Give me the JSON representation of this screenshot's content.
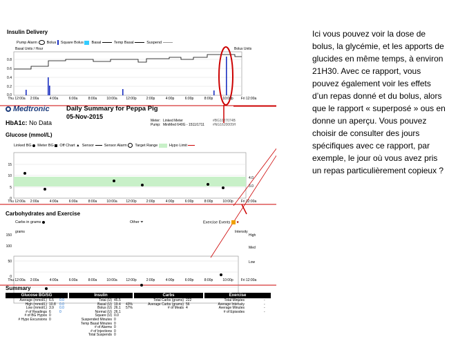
{
  "insulin_delivery": {
    "title": "Insulin Delivery",
    "legend": {
      "pump_alarm": "Pump Alarm",
      "bolus": "Bolus",
      "square_bolus": "Square Bolus",
      "basal": "Basal",
      "temp_basal": "Temp Basal",
      "suspend": "Suspend"
    },
    "y_label_left": "Basal Units / Hour",
    "y_label_right": "Bolus Units",
    "y_ticks": [
      "0.8",
      "0.6",
      "0.4",
      "0.2",
      "0.0"
    ],
    "x_ticks": [
      "Thu 12:00a",
      "2:00a",
      "4:00a",
      "6:00a",
      "8:00a",
      "10:00a",
      "12:00p",
      "2:00p",
      "4:00p",
      "6:00p",
      "8:00p",
      "10:00p",
      "Fri 12:00a"
    ]
  },
  "header": {
    "brand": "Medtronic",
    "title": "Daily Summary for Peppa Pig",
    "date": "05-Nov-2015",
    "meter_label": "Meter:",
    "meter_value": "Linked Meter",
    "meter_id": "#BG1027074B",
    "pump_label": "Pump:",
    "pump_value": "MiniMed 640G - 1511/1711",
    "pump_id": "#NG1620005H"
  },
  "hba1c": {
    "label": "HbA1c:",
    "value": "No Data"
  },
  "glucose": {
    "title": "Glucose (mmol/L)",
    "legend": {
      "linked_bg": "Linked BG",
      "meter_bg": "Meter BG",
      "off_chart": "Off Chart",
      "sensor": "Sensor",
      "sensor_alarm": "Sensor Alarm",
      "target_range": "Target Range",
      "hypo_limit": "Hypo Limit"
    },
    "y_ticks": [
      "15",
      "10",
      "5",
      "0"
    ],
    "right_ticks": [
      "4.0",
      "3.0"
    ],
    "x_ticks": [
      "Thu 12:00a",
      "2:00a",
      "4:00a",
      "6:00a",
      "8:00a",
      "10:00a",
      "12:00p",
      "2:00p",
      "4:00p",
      "6:00p",
      "8:00p",
      "10:00p",
      "Fri 12:00a"
    ]
  },
  "carbs": {
    "title": "Carbohydrates and Exercise",
    "legend": {
      "carbs_in_grams": "Carbs in grams",
      "other": "Other",
      "exercise_events": "Exercise Events"
    },
    "y_label_left": "grams",
    "y_label_right": "Intensity",
    "y_ticks": [
      "150",
      "100",
      "50",
      "0"
    ],
    "right_ticks": [
      "High",
      "Med",
      "Low"
    ],
    "x_ticks": [
      "Thu 12:00a",
      "2:00a",
      "4:00a",
      "6:00a",
      "8:00a",
      "10:00a",
      "12:00p",
      "2:00p",
      "4:00p",
      "6:00p",
      "8:00p",
      "10:00p",
      "Fri 12:00a"
    ]
  },
  "summary": {
    "title": "Summary",
    "glucose": {
      "header": "Glucose BG/SG",
      "rows": [
        {
          "label": "Average (mmol/L)",
          "v1": "6.5",
          "v2": "0.0"
        },
        {
          "label": "High (mmol/L)",
          "v1": "10.8",
          "v2": "0.0"
        },
        {
          "label": "Low (mmol/L)",
          "v1": "3.9",
          "v2": "0.0"
        },
        {
          "label": "# of Readings",
          "v1": "6",
          "v2": "0"
        },
        {
          "label": "# of BG Hypos",
          "v1": "0",
          "v2": ""
        },
        {
          "label": "# Hypo Excursions",
          "v1": "0",
          "v2": ""
        }
      ]
    },
    "insulin": {
      "header": "Insulin",
      "rows": [
        {
          "label": "Total (U)",
          "v1": "45.5",
          "v2": ""
        },
        {
          "label": "Basal (U)",
          "v1": "19.4",
          "v2": "43%"
        },
        {
          "label": "Bolus (U)",
          "v1": "26.1",
          "v2": "57%"
        },
        {
          "label": "Normal (U)",
          "v1": "26.1",
          "v2": ""
        },
        {
          "label": "Square (U)",
          "v1": "0.0",
          "v2": ""
        },
        {
          "label": "Suspended Minutes",
          "v1": "0",
          "v2": ""
        },
        {
          "label": "Temp Basal Minutes",
          "v1": "0",
          "v2": ""
        },
        {
          "label": "# of Alarms",
          "v1": "0",
          "v2": ""
        },
        {
          "label": "# of Injections",
          "v1": "0",
          "v2": ""
        },
        {
          "label": "Total Suspends",
          "v1": "0",
          "v2": ""
        }
      ]
    },
    "carbs": {
      "header": "Carbs",
      "rows": [
        {
          "label": "Total Carbs (grams)",
          "v1": "222"
        },
        {
          "label": "Average Carbs (grams)",
          "v1": "56"
        },
        {
          "label": "# of Meals",
          "v1": "4"
        }
      ]
    },
    "exercise": {
      "header": "Exercise",
      "rows": [
        {
          "label": "Total Minutes",
          "v1": "-"
        },
        {
          "label": "Average Intensity",
          "v1": "-"
        },
        {
          "label": "Average Minutes",
          "v1": "-"
        },
        {
          "label": "# of Episodes",
          "v1": "-"
        }
      ]
    }
  },
  "annotation": {
    "text": "Ici vous pouvez voir la dose de bolus, la glycémie, et les apports de glucides en même temps, à environ 21H30. Avec ce rapport, vous pouvez également voir les effets d’un repas donné et du bolus, alors que le rapport « superposé » ous en donne un aperçu. Vous pouvez choisir de consulter des jours spécifiques  avec ce rapport, par exemple, le jour où vous avez pris un repas particulièrement copieux ?"
  },
  "colors": {
    "red_marker": "#cc0000",
    "target_range": "#c8f0c8",
    "blue_bolus": "#1a2fc0",
    "cyan_square": "#33ccff",
    "brand": "#1a3a7a"
  }
}
